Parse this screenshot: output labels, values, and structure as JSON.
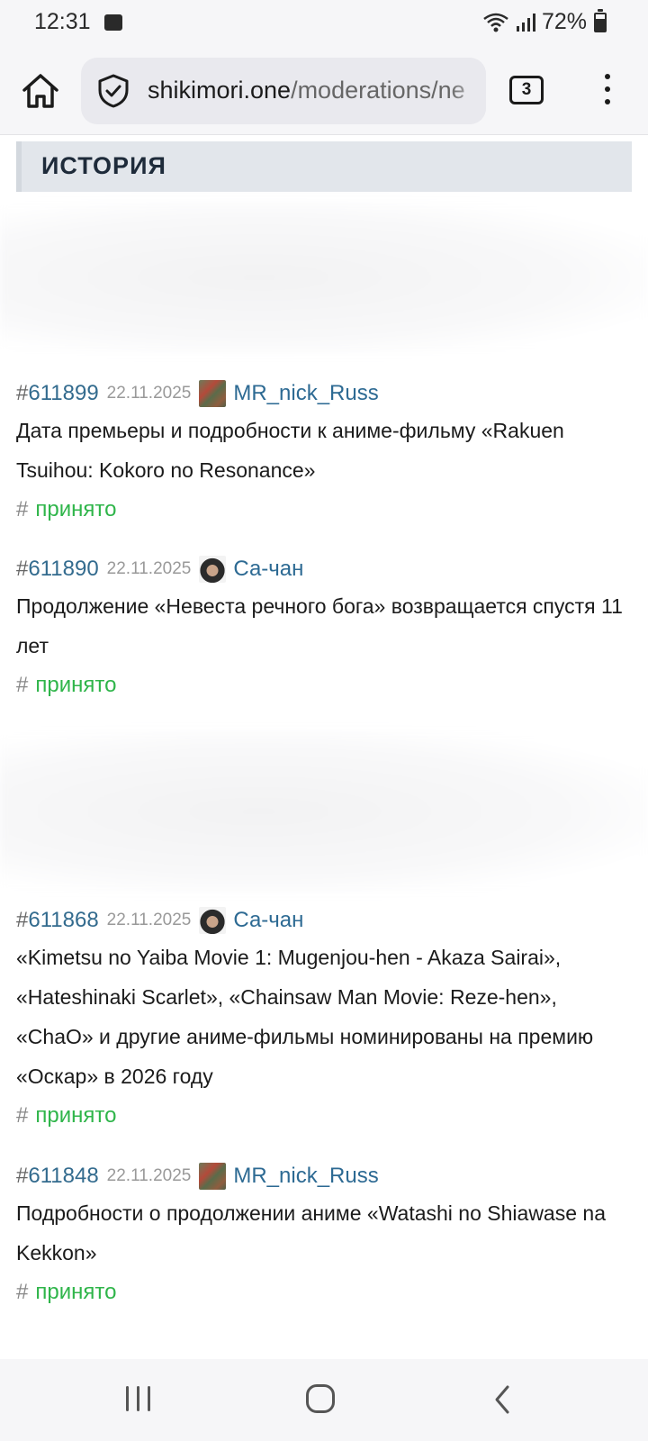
{
  "status_bar": {
    "time": "12:31",
    "battery": "72%",
    "icons": [
      "image-icon",
      "wifi-icon",
      "signal-icon",
      "battery-icon"
    ]
  },
  "browser": {
    "url_domain": "shikimori.one",
    "url_path": "/moderations/ne",
    "tab_count": "3"
  },
  "section": {
    "title": "ИСТОРИЯ"
  },
  "entries": [
    {
      "hash": "#",
      "id": "611899",
      "date": "22.11.2025",
      "user": "MR_nick_Russ",
      "title": "Дата премьеры и подробности к аниме-фильму «Rakuen Tsuihou: Kokoro no Resonance»",
      "status": "принято"
    },
    {
      "hash": "#",
      "id": "611890",
      "date": "22.11.2025",
      "user": "Са-чан",
      "title": "Продолжение «Невеста речного бога» возвращается спустя 11 лет",
      "status": "принято"
    },
    {
      "hash": "#",
      "id": "611868",
      "date": "22.11.2025",
      "user": "Са-чан",
      "title": "«Kimetsu no Yaiba Movie 1: Mugenjou-hen - Akaza Sairai», «Hateshinaki Scarlet», «Chainsaw Man Movie: Reze-hen», «ChaO» и другие аниме-фильмы номинированы на премию «Оскар» в 2026 году",
      "status": "принято"
    },
    {
      "hash": "#",
      "id": "611848",
      "date": "22.11.2025",
      "user": "MR_nick_Russ",
      "title": "Подробности о продолжении аниме «Watashi no Shiawase na Kekkon»",
      "status": "принято"
    }
  ],
  "colors": {
    "id_link": "#336b8e",
    "user_link": "#2d6a93",
    "accepted": "#2fb54a",
    "section_bg": "#e2e6eb"
  }
}
